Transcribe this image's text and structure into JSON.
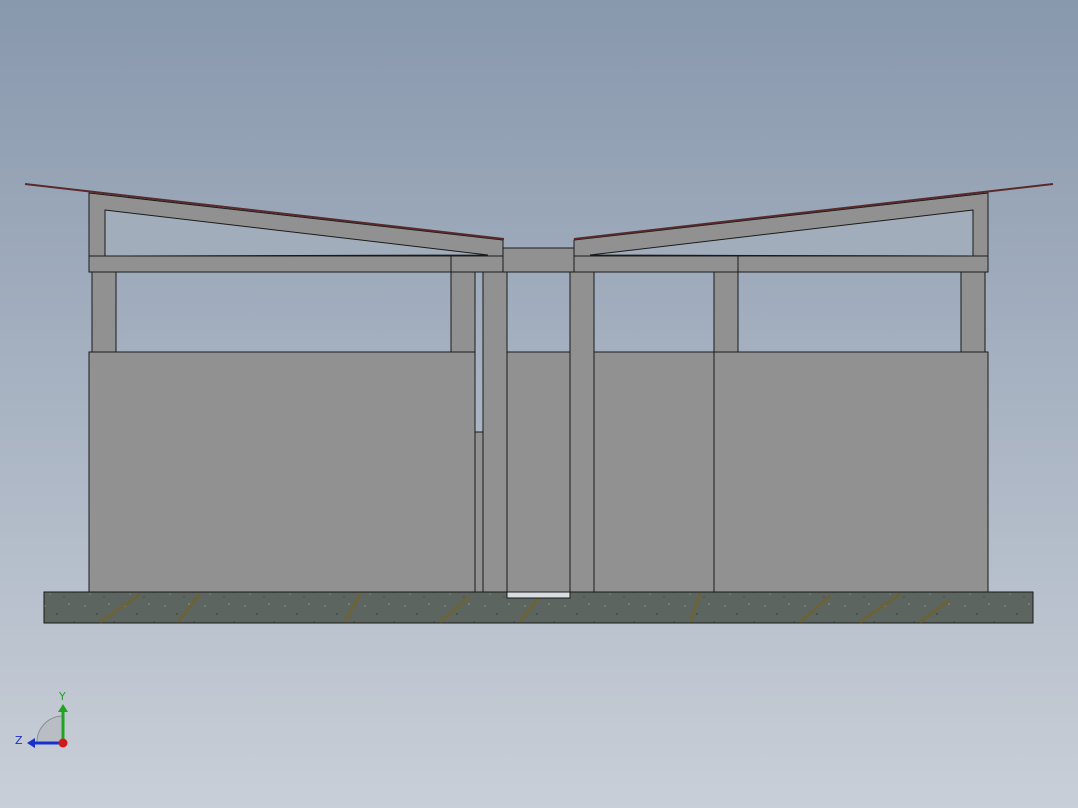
{
  "view": {
    "background_top": "#8898ad",
    "background_bottom": "#c9cfd8"
  },
  "model": {
    "wall_color": "#919191",
    "edge_color": "#1a1a1a",
    "roof_edge_color": "#5a2a2a",
    "glass_color": "#a2adbc",
    "base_color": "#5c6560",
    "base_streak_color": "#6e6330"
  },
  "triad": {
    "y_label": "Y",
    "z_label": "Z",
    "y_color": "#1fa51f",
    "z_color": "#1a2fd0",
    "x_color": "#d01a1a"
  }
}
